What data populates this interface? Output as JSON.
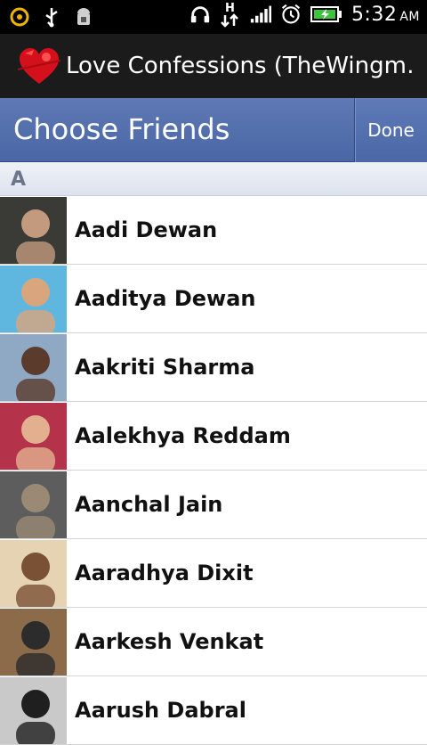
{
  "status_bar": {
    "time": "5:32",
    "ampm": "AM",
    "network": "H"
  },
  "app": {
    "title": "Love Confessions (TheWingm…"
  },
  "picker": {
    "title": "Choose Friends",
    "done_label": "Done"
  },
  "section": {
    "letter": "A"
  },
  "friends": [
    {
      "name": "Aadi Dewan",
      "avatar_bg": "#3a3a36",
      "avatar_accent": "#c39a7e"
    },
    {
      "name": "Aaditya Dewan",
      "avatar_bg": "#5fb7e0",
      "avatar_accent": "#d8a57c"
    },
    {
      "name": "Aakriti Sharma",
      "avatar_bg": "#8fa9c4",
      "avatar_accent": "#5a3b2c"
    },
    {
      "name": "Aalekhya Reddam",
      "avatar_bg": "#b5334a",
      "avatar_accent": "#e2b08e"
    },
    {
      "name": "Aanchal Jain",
      "avatar_bg": "#5d5d5d",
      "avatar_accent": "#9a8a74"
    },
    {
      "name": "Aaradhya Dixit",
      "avatar_bg": "#e6d3b3",
      "avatar_accent": "#7a5134"
    },
    {
      "name": "Aarkesh Venkat",
      "avatar_bg": "#8b6b4a",
      "avatar_accent": "#2c2c2c"
    },
    {
      "name": "Aarush Dabral",
      "avatar_bg": "#c9c9c9",
      "avatar_accent": "#1f1f1f"
    }
  ],
  "colors": {
    "header_blue": "#4e6aa8",
    "status_bar": "#000000",
    "app_bar": "#1b1b1b"
  }
}
